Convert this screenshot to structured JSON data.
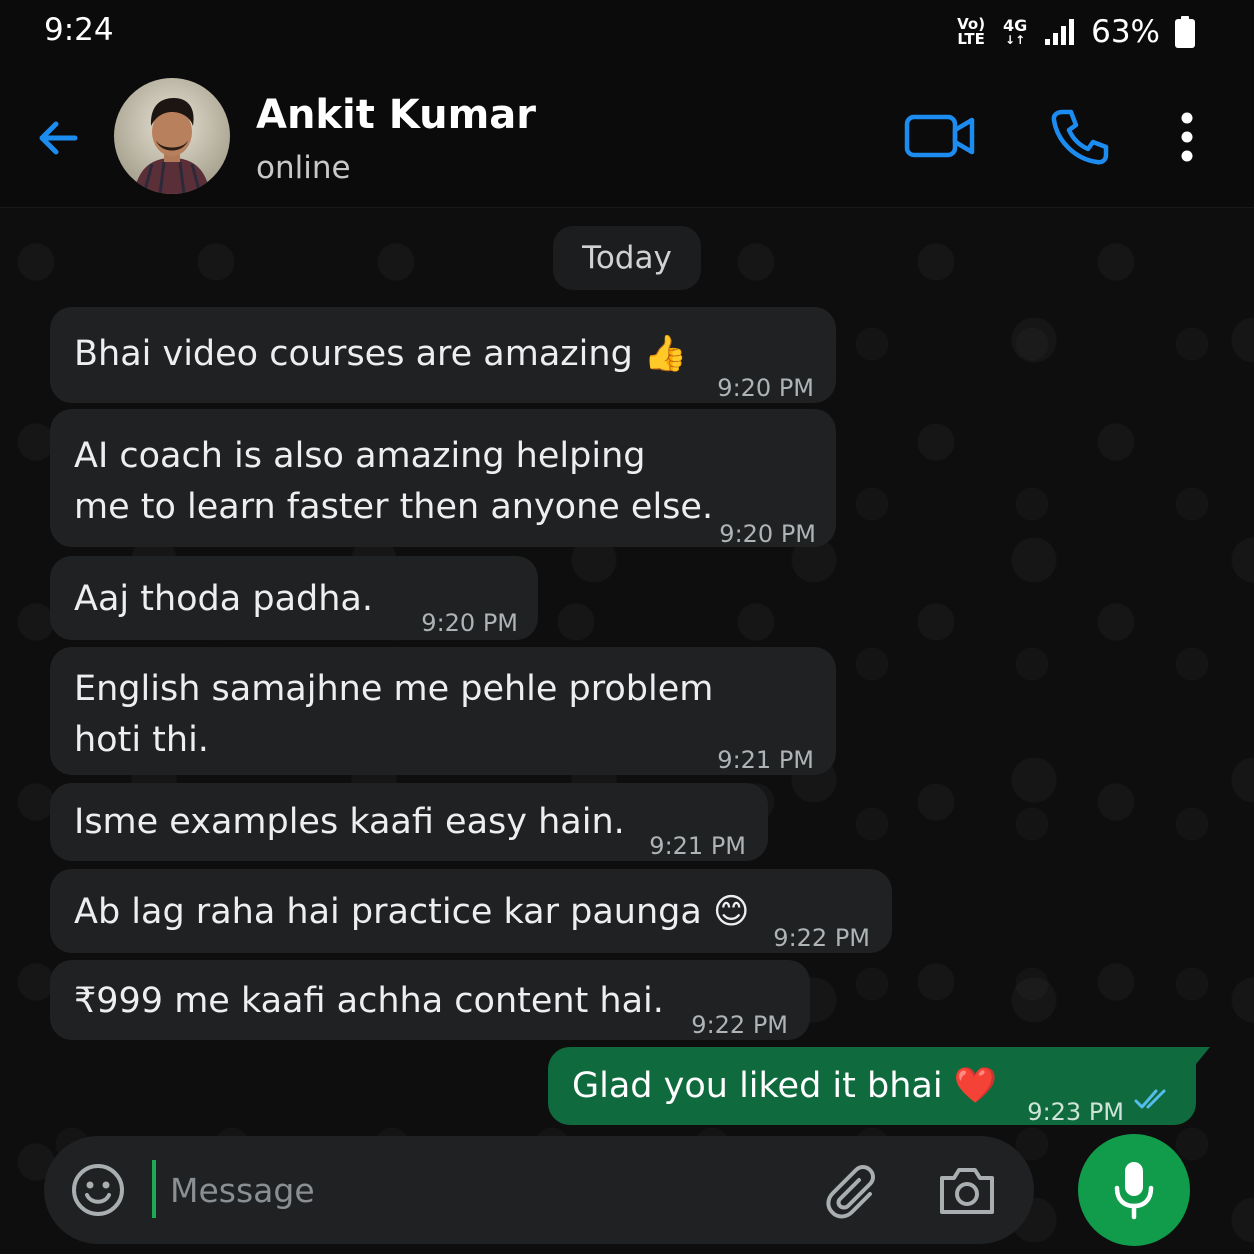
{
  "status_bar": {
    "time": "9:24",
    "volte_top": "Vo)",
    "volte_bottom": "LTE",
    "network": "4G",
    "battery": "63%"
  },
  "header": {
    "contact_name": "Ankit Kumar",
    "contact_status": "online",
    "back_icon": "back-arrow-icon",
    "video_icon": "video-call-icon",
    "call_icon": "phone-icon",
    "menu_icon": "more-vertical-icon",
    "accent_color": "#1d8cf0"
  },
  "chat": {
    "date_chip": "Today",
    "messages": [
      {
        "direction": "incoming",
        "lines": [
          "Bhai video courses are amazing 👍"
        ],
        "time": "9:20 PM"
      },
      {
        "direction": "incoming",
        "lines": [
          "AI coach is also amazing helping",
          "me to learn faster then anyone else."
        ],
        "time": "9:20 PM"
      },
      {
        "direction": "incoming",
        "lines": [
          "Aaj thoda padha."
        ],
        "time": "9:20 PM"
      },
      {
        "direction": "incoming",
        "lines": [
          "English samajhne me pehle problem",
          "hoti thi."
        ],
        "time": "9:21 PM"
      },
      {
        "direction": "incoming",
        "lines": [
          "Isme examples kaafi easy hain."
        ],
        "time": "9:21 PM"
      },
      {
        "direction": "incoming",
        "lines": [
          "Ab lag raha hai practice kar paunga 😊"
        ],
        "time": "9:22 PM"
      },
      {
        "direction": "incoming",
        "lines": [
          "₹999 me kaafi achha content hai."
        ],
        "time": "9:22 PM"
      },
      {
        "direction": "outgoing",
        "lines": [
          "Glad you liked it bhai ❤️"
        ],
        "time": "9:23 PM",
        "read_receipt": "double-check-icon"
      }
    ],
    "incoming_bubble_color": "#1f2123",
    "outgoing_bubble_color": "#0f6b3e"
  },
  "composer": {
    "placeholder": "Message",
    "emoji_icon": "emoji-icon",
    "attach_icon": "paperclip-icon",
    "camera_icon": "camera-icon",
    "mic_icon": "microphone-icon",
    "mic_color": "#119c4c"
  }
}
